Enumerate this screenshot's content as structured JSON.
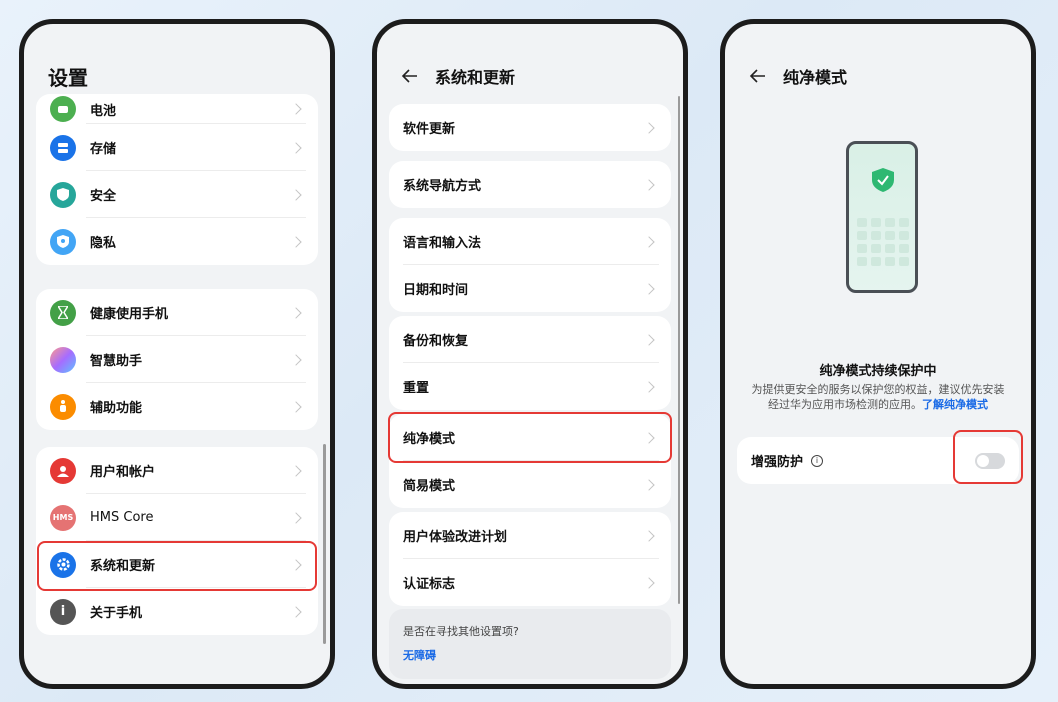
{
  "phone1": {
    "title": "设置",
    "group1": [
      {
        "label": "电池",
        "icon": "battery-icon",
        "color": "#4caf50"
      },
      {
        "label": "存储",
        "icon": "storage-icon",
        "color": "#1a73e8"
      },
      {
        "label": "安全",
        "icon": "security-shield-icon",
        "color": "#26a69a"
      },
      {
        "label": "隐私",
        "icon": "privacy-icon",
        "color": "#42a5f5"
      }
    ],
    "group2": [
      {
        "label": "健康使用手机",
        "icon": "hourglass-icon",
        "color": "#43a047"
      },
      {
        "label": "智慧助手",
        "icon": "assistant-icon",
        "color": "#ab47bc"
      },
      {
        "label": "辅助功能",
        "icon": "accessibility-icon",
        "color": "#fb8c00"
      }
    ],
    "group3": [
      {
        "label": "用户和帐户",
        "icon": "user-icon",
        "color": "#e53935"
      },
      {
        "label": "HMS Core",
        "icon": "hms-icon",
        "color": "#e57373",
        "text": "HMS"
      },
      {
        "label": "系统和更新",
        "icon": "settings-gear-icon",
        "color": "#1a73e8"
      },
      {
        "label": "关于手机",
        "icon": "info-icon",
        "color": "#555555",
        "text": "i"
      }
    ]
  },
  "phone2": {
    "title": "系统和更新",
    "cards": [
      [
        "软件更新"
      ],
      [
        "系统导航方式"
      ],
      [
        "语言和输入法",
        "日期和时间"
      ],
      [
        "备份和恢复",
        "重置"
      ],
      [
        "纯净模式",
        "简易模式"
      ],
      [
        "用户体验改进计划",
        "认证标志"
      ]
    ],
    "search_prompt": "是否在寻找其他设置项?",
    "search_keyword": "无障碍"
  },
  "phone3": {
    "title": "纯净模式",
    "protect_title": "纯净模式持续保护中",
    "protect_desc": "为提供更安全的服务以保护您的权益，建议优先安装经过华为应用市场检测的应用。",
    "protect_link": "了解纯净模式",
    "enhance_label": "增强防护",
    "enhance_on": false
  },
  "colors": {
    "highlight": "#e53935",
    "link": "#1a6ae6"
  }
}
